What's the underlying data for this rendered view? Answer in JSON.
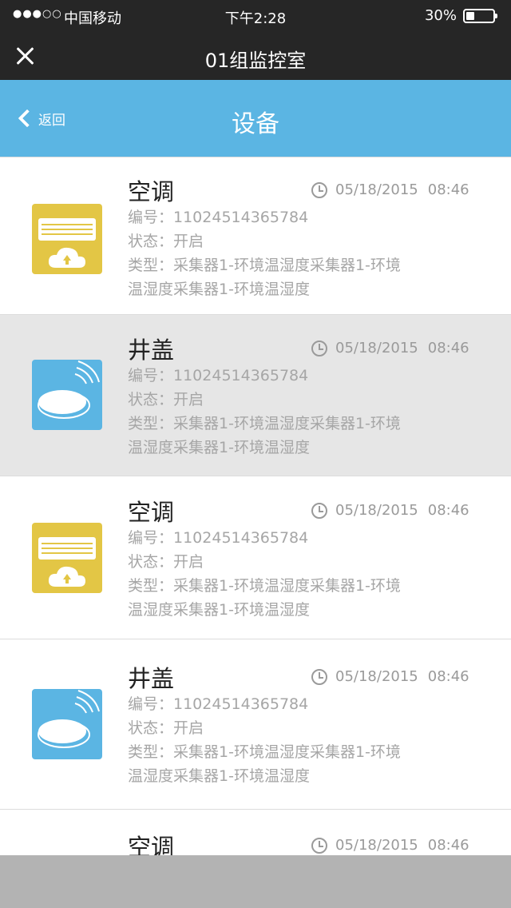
{
  "status_bar": {
    "signal": "●●●○○",
    "carrier": "中国移动",
    "time": "下午2:28",
    "battery_text": "30%",
    "battery_level": 0.3
  },
  "title_bar": {
    "title": "01组监控室"
  },
  "nav": {
    "back_label": "返回",
    "title": "设备"
  },
  "devices": [
    {
      "name": "空调",
      "icon": "air-conditioner-icon",
      "date": "05/18/2015",
      "time": "08:46",
      "serial": "编号：11024514365784",
      "status": "状态：开启",
      "type_line1": "类型：采集器1-环境温湿度采集器1-环境",
      "type_line2": "温湿度采集器1-环境温湿度"
    },
    {
      "name": "井盖",
      "icon": "manhole-cover-icon",
      "date": "05/18/2015",
      "time": "08:46",
      "serial": "编号：11024514365784",
      "status": "状态：开启",
      "type_line1": "类型：采集器1-环境温湿度采集器1-环境",
      "type_line2": "温湿度采集器1-环境温湿度"
    },
    {
      "name": "空调",
      "icon": "air-conditioner-icon",
      "date": "05/18/2015",
      "time": "08:46",
      "serial": "编号：11024514365784",
      "status": "状态：开启",
      "type_line1": "类型：采集器1-环境温湿度采集器1-环境",
      "type_line2": "温湿度采集器1-环境温湿度"
    },
    {
      "name": "井盖",
      "icon": "manhole-cover-icon",
      "date": "05/18/2015",
      "time": "08:46",
      "serial": "编号：11024514365784",
      "status": "状态：开启",
      "type_line1": "类型：采集器1-环境温湿度采集器1-环境",
      "type_line2": "温湿度采集器1-环境温湿度"
    },
    {
      "name": "空调",
      "date": "05/18/2015",
      "time": "08:46"
    }
  ],
  "colors": {
    "status_bar": "#262626",
    "nav_bar": "#5bb5e3",
    "ac_icon_bg": "#e3c645",
    "manhole_icon_bg": "#5bb5e3",
    "selected_row": "#e6e6e6",
    "bottom_bar": "#b3b3b3"
  }
}
